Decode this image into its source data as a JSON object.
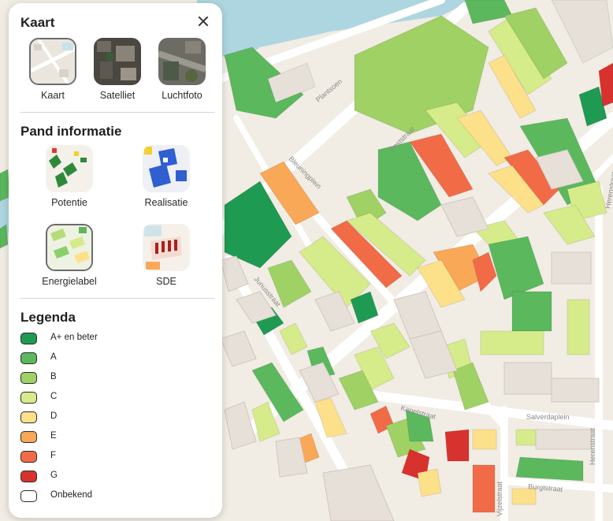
{
  "map": {
    "streets": [
      "Plantsoen",
      "Poststraat",
      "Bleuningplein",
      "Junusstraat",
      "Kapelstraat",
      "Salverdaplein",
      "Herenstraat",
      "Vijzelstraat",
      "Burgtstraat"
    ],
    "colors": {
      "water": "#aed6e0",
      "land": "#f1ece4",
      "road": "#ffffff",
      "building": "#e7e0d8",
      "building_stroke": "#c9c1b7"
    }
  },
  "panel": {
    "kaart": {
      "title": "Kaart",
      "close_icon": "close-icon",
      "tiles": [
        {
          "label": "Kaart",
          "selected": true
        },
        {
          "label": "Satelliet",
          "selected": false
        },
        {
          "label": "Luchtfoto",
          "selected": false
        }
      ]
    },
    "pand": {
      "title": "Pand informatie",
      "tiles": [
        {
          "label": "Potentie",
          "selected": false
        },
        {
          "label": "Realisatie",
          "selected": false
        },
        {
          "label": "Energielabel",
          "selected": true
        },
        {
          "label": "SDE",
          "selected": false
        }
      ]
    },
    "legend": {
      "title": "Legenda",
      "items": [
        {
          "label": "A+ en beter",
          "color": "#1f9a52"
        },
        {
          "label": "A",
          "color": "#5bb85d"
        },
        {
          "label": "B",
          "color": "#9fd164"
        },
        {
          "label": "C",
          "color": "#d6eb8a"
        },
        {
          "label": "D",
          "color": "#fde08a"
        },
        {
          "label": "E",
          "color": "#f9a857"
        },
        {
          "label": "F",
          "color": "#f26b47"
        },
        {
          "label": "G",
          "color": "#d8322e"
        },
        {
          "label": "Onbekend",
          "color": "#ffffff"
        }
      ]
    }
  }
}
